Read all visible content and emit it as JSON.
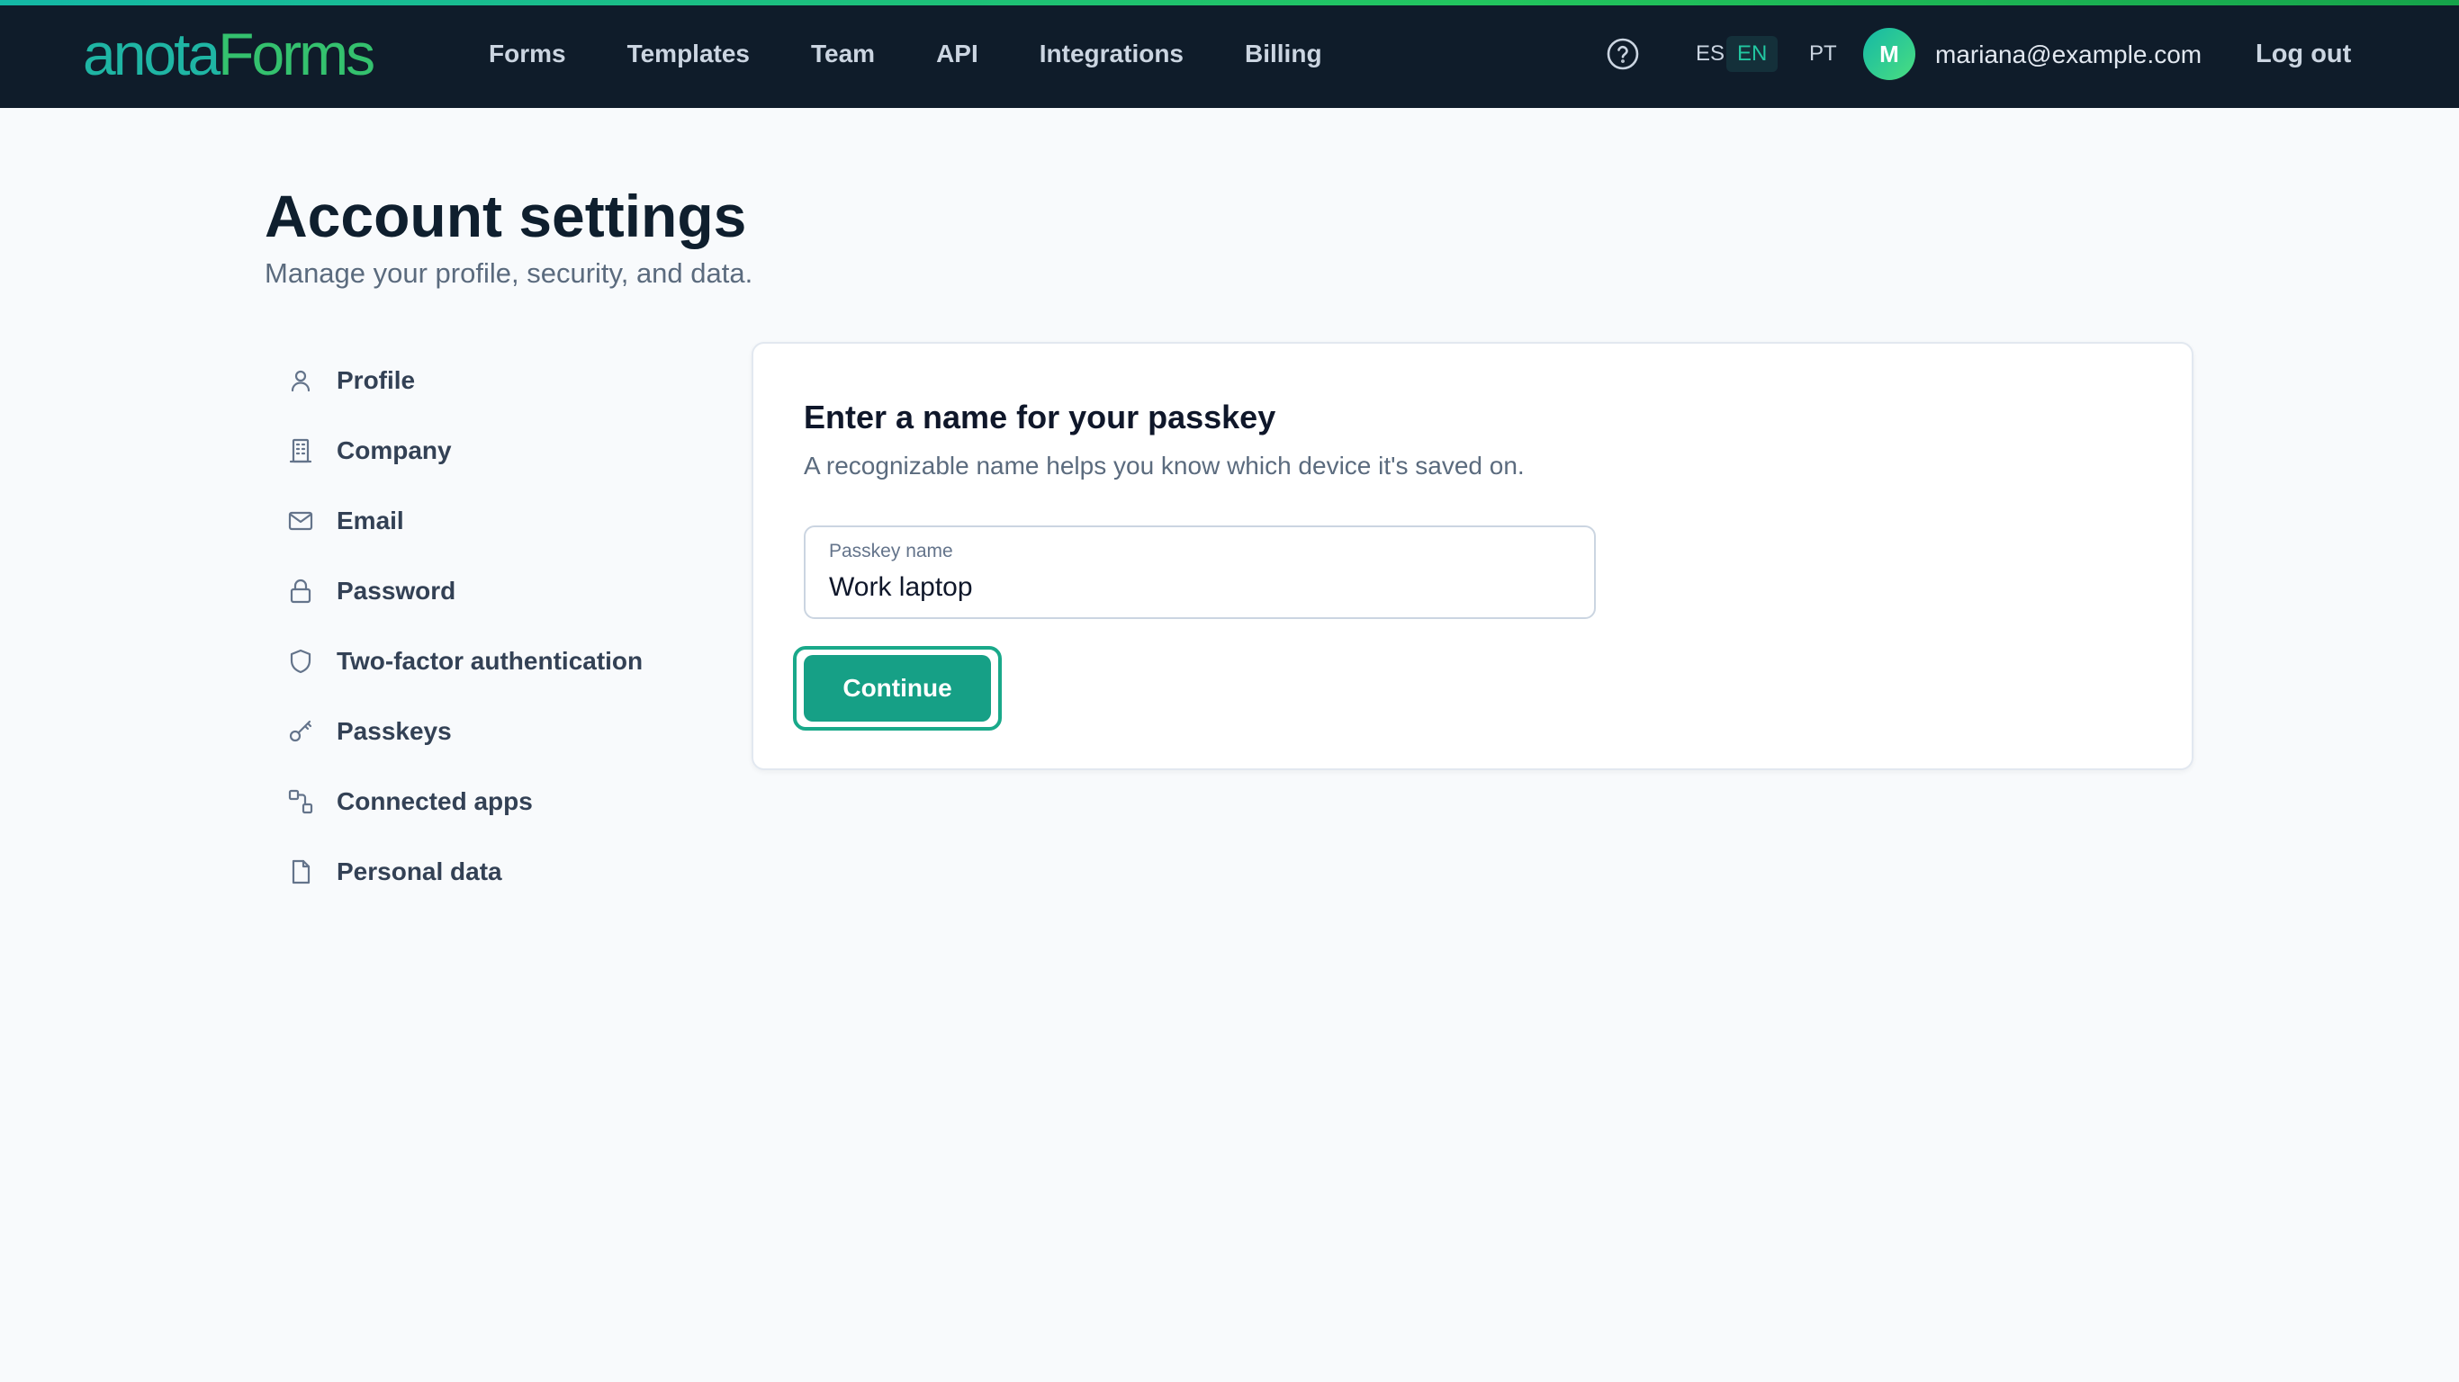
{
  "brand": {
    "logo_part1": "anota",
    "logo_part2": "Forms"
  },
  "nav": [
    "Forms",
    "Templates",
    "Team",
    "API",
    "Integrations",
    "Billing"
  ],
  "header": {
    "help_icon": "question-circle-icon",
    "languages": [
      "ES",
      "EN",
      "PT"
    ],
    "active_language": "EN",
    "avatar_initial": "M",
    "user_email": "mariana@example.com",
    "logout_label": "Log out"
  },
  "page": {
    "title": "Account settings",
    "subtitle": "Manage your profile, security, and data."
  },
  "sidebar": {
    "items": [
      {
        "label": "Profile",
        "icon": "user-icon"
      },
      {
        "label": "Company",
        "icon": "building-icon"
      },
      {
        "label": "Email",
        "icon": "mail-icon"
      },
      {
        "label": "Password",
        "icon": "lock-icon"
      },
      {
        "label": "Two-factor authentication",
        "icon": "shield-icon"
      },
      {
        "label": "Passkeys",
        "icon": "key-icon"
      },
      {
        "label": "Connected apps",
        "icon": "link-apps-icon"
      },
      {
        "label": "Personal data",
        "icon": "file-icon"
      }
    ]
  },
  "passkey_form": {
    "title": "Enter a name for your passkey",
    "description": "A recognizable name helps you know which device it's saved on.",
    "field_label": "Passkey name",
    "field_value": "Work laptop",
    "continue_label": "Continue"
  },
  "colors": {
    "topbar_bg": "#0f1c2a",
    "accent": "#16a086",
    "logo_teal": "#1fb5a4",
    "logo_green": "#34c16e"
  }
}
